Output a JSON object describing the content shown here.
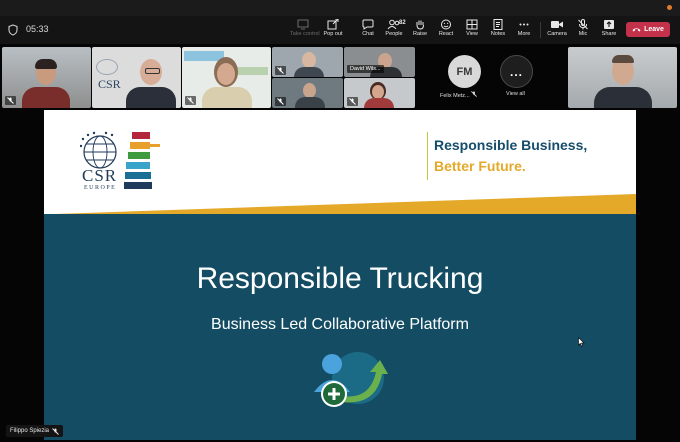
{
  "meeting": {
    "timer": "05:33",
    "toolbar": {
      "take_control": "Take control",
      "pop_out": "Pop out",
      "chat": "Chat",
      "people": "People",
      "people_count": "82",
      "raise": "Raise",
      "react": "React",
      "view": "View",
      "notes": "Notes",
      "more": "More",
      "camera": "Camera",
      "mic": "Mic",
      "share": "Share",
      "leave": "Leave"
    },
    "participants": {
      "tile_david": "David Wils...",
      "avatar_initials": "FM",
      "avatar_name": "Felix Metz...",
      "view_all": "View all",
      "view_all_glyph": "..."
    },
    "presenter": "Filippo Spiezia"
  },
  "slide": {
    "tagline_line1": "Responsible Business,",
    "tagline_line2": "Better Future.",
    "logo_text": "CSR",
    "logo_sub": "EUROPE",
    "title": "Responsible Trucking",
    "subtitle": "Business Led Collaborative Platform"
  },
  "colors": {
    "leave_button": "#c4314b",
    "slide_background": "#144d63",
    "tagline_blue": "#154d6b",
    "tagline_gold": "#e5a92a"
  }
}
